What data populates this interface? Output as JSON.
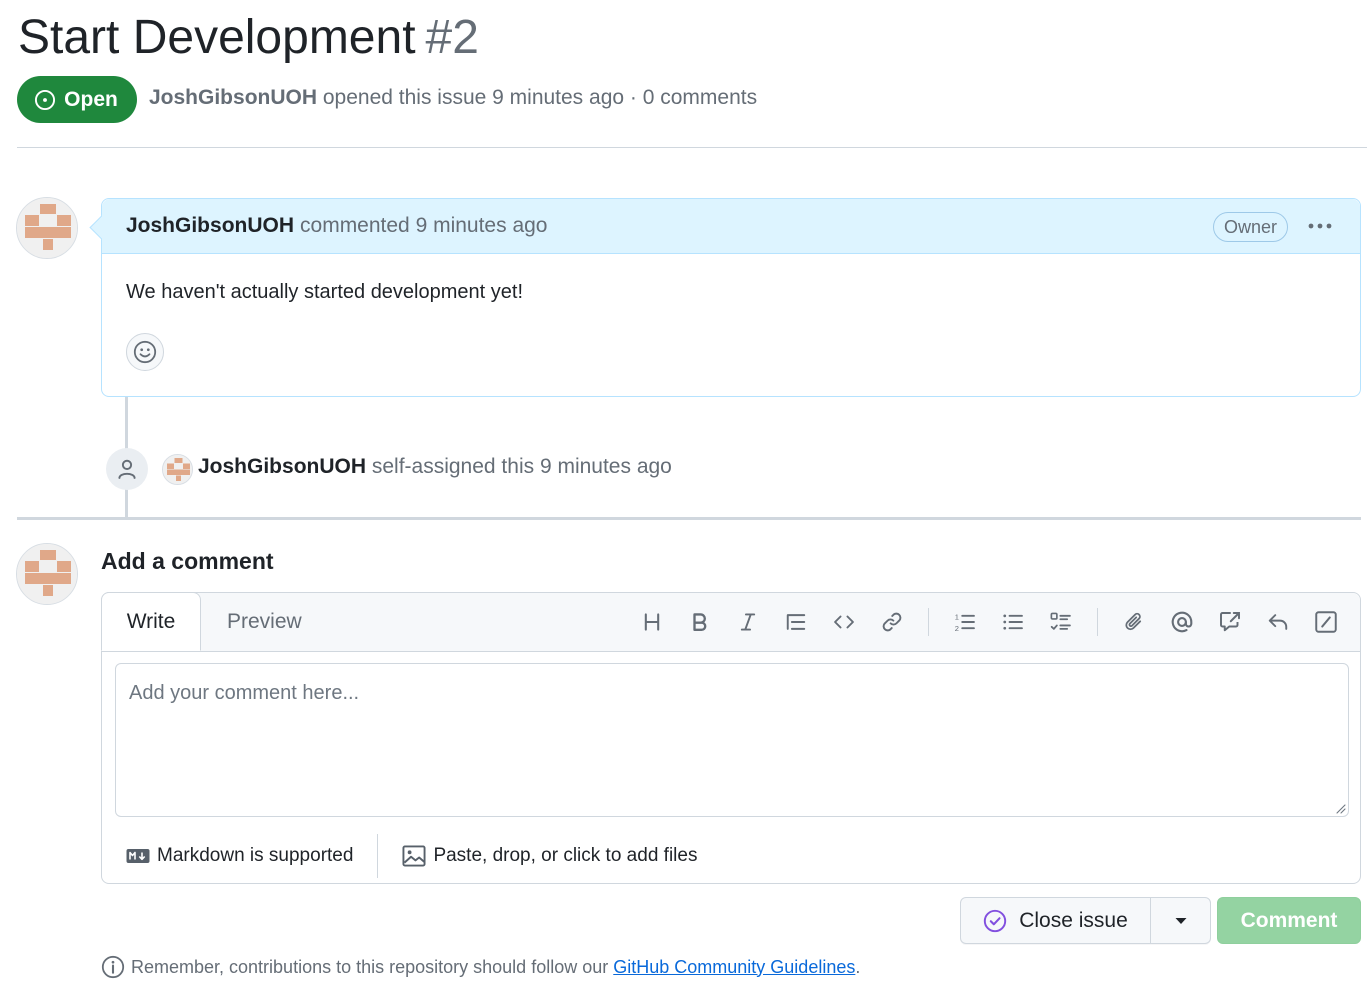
{
  "issue": {
    "title": "Start Development",
    "number": "#2",
    "state": "Open",
    "author": "JoshGibsonUOH",
    "opened_text": "opened this issue 9 minutes ago · 0 comments"
  },
  "comment": {
    "author": "JoshGibsonUOH",
    "time_text": "commented 9 minutes ago",
    "role_badge": "Owner",
    "body": "We haven't actually started development yet!"
  },
  "event": {
    "actor": "JoshGibsonUOH",
    "text": "self-assigned this 9 minutes ago"
  },
  "new_comment": {
    "heading": "Add a comment",
    "tabs": {
      "write": "Write",
      "preview": "Preview"
    },
    "placeholder": "Add your comment here...",
    "markdown_hint": "Markdown is supported",
    "attach_hint": "Paste, drop, or click to add files",
    "toolbar": [
      "heading-icon",
      "bold-icon",
      "italic-icon",
      "quote-icon",
      "code-icon",
      "link-icon",
      "ordered-list-icon",
      "unordered-list-icon",
      "task-list-icon",
      "attach-icon",
      "mention-icon",
      "reference-icon",
      "reply-icon",
      "slash-command-icon"
    ]
  },
  "actions": {
    "close_label": "Close issue",
    "comment_label": "Comment"
  },
  "footer": {
    "prefix": "Remember, contributions to this repository should follow our",
    "link": "GitHub Community Guidelines",
    "suffix": "."
  },
  "colors": {
    "open_green": "#1f883d",
    "comment_header_bg": "#ddf4ff",
    "comment_border": "#b6e3ff",
    "disabled_comment_btn": "#94d3a2",
    "link_blue": "#0969da",
    "close_icon_purple": "#8250df"
  }
}
